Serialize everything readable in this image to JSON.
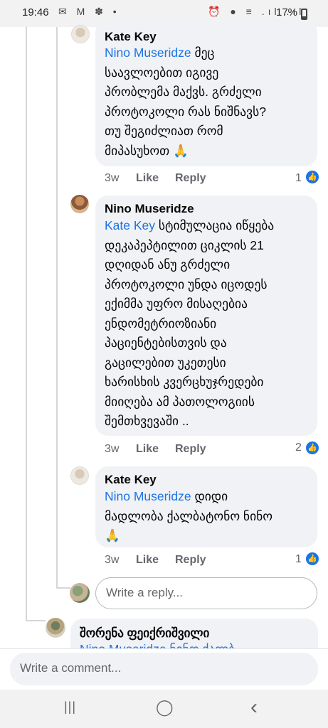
{
  "status_bar": {
    "time": "19:46",
    "left_icons": "✉ M ✽ •",
    "right_icons": "⏰ ● ≡ .ıl .ıl",
    "battery": "17%"
  },
  "comments": [
    {
      "author": "Kate Key",
      "mention": "Nino Museridze",
      "text": " მეც\nსაავლოებით იგივე\nპრობლემა მაქვს. გრძელი\nპროტოკოლი რას ნიშნავს?\nთუ შეგიძლიათ რომ\nმიპასუხოთ 🙏",
      "time": "3w",
      "like_label": "Like",
      "reply_label": "Reply",
      "likes": "1"
    },
    {
      "author": "Nino Museridze",
      "mention": "Kate Key",
      "text": " სტიმულაცია იწყება\nდეკაპეპტილით ციკლის 21\nდღიდან ანუ გრძელი\nპროტოკოლი უნდა იცოდეს\nექიმმა უფრო მისაღებია\nენდომეტრიოზიანი\nპაციენტებისთვის და\nგაცილებით უკეთესი\nხარისხის კვერცხუჯრედები\nმიიღება ამ პათოლოგიის\nშემთხვევაში ..",
      "time": "3w",
      "like_label": "Like",
      "reply_label": "Reply",
      "likes": "2"
    },
    {
      "author": "Kate Key",
      "mention": "Nino Museridze",
      "text": " დიდი\nმადლობა ქალბატონო ნინო\n🙏",
      "time": "3w",
      "like_label": "Like",
      "reply_label": "Reply",
      "likes": "1"
    }
  ],
  "reply_placeholder": "Write a reply...",
  "next_comment": {
    "author": "შორენა ფეიქრიშვილი",
    "partial_text": "Nino Museridze ნინო ქალბ"
  },
  "comment_placeholder": "Write a comment...",
  "nav": {
    "recents": "|||",
    "home": "◯",
    "back": "‹"
  },
  "colors": {
    "mention": "#1b74e4",
    "bubble": "#f0f2f5",
    "meta": "#65676b"
  }
}
